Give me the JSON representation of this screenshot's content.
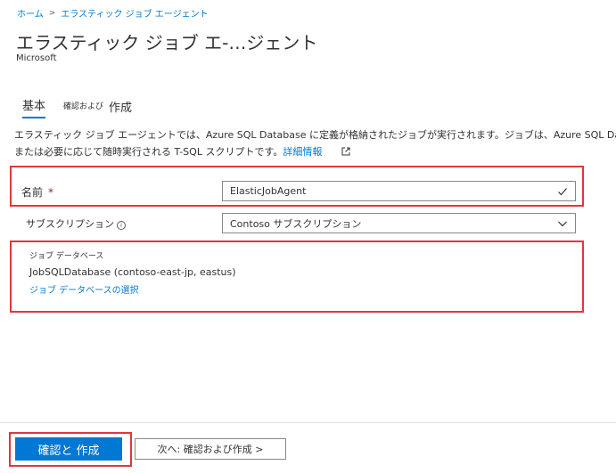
{
  "breadcrumb": {
    "home": "ホーム",
    "separator": ">",
    "current": "エラスティック ジョブ エージェント"
  },
  "page": {
    "title": "エラスティック ジョブ エ-…ジェント",
    "publisher": "Microsoft"
  },
  "tabs": {
    "basics": "基本",
    "review_small": "確認および",
    "create": "作成"
  },
  "description": {
    "line1": "エラスティック ジョブ エージェントでは、Azure SQL Database に定義が格納されたジョブが実行されます。ジョブは、Azure SQL Database のグルー",
    "line2": "または必要に応じて随時実行される T-SQL スクリプトです。",
    "learn_more": "詳細情報"
  },
  "form": {
    "name_label": "名前",
    "required_mark": "*",
    "name_value": "ElasticJobAgent",
    "subscription_label": "サブスクリプション",
    "info_glyph": "i",
    "subscription_value": "Contoso サブスクリプション"
  },
  "job_database": {
    "title": "ジョブ データベース",
    "value": "JobSQLDatabase (contoso-east-jp, eastus)",
    "select_link": "ジョブ データベースの選択"
  },
  "footer": {
    "review_create": "確認と 作成",
    "next": "次へ: 確認および作成 >"
  },
  "colors": {
    "accent": "#0078d4",
    "highlight": "#e0373d",
    "required": "#a4262c"
  }
}
